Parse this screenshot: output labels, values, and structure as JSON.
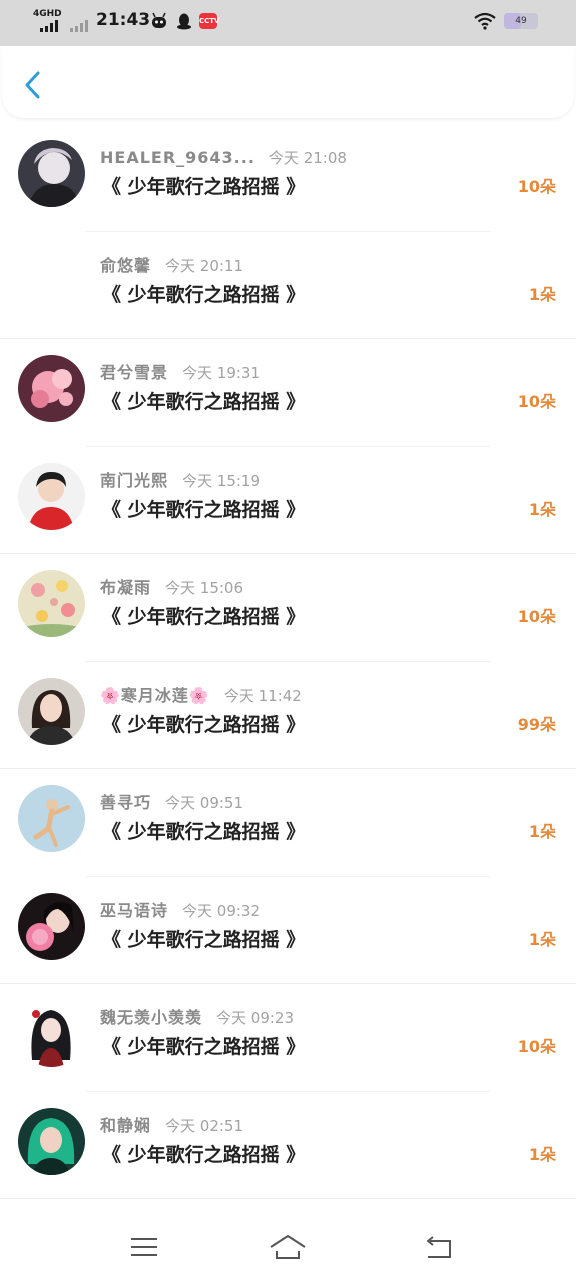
{
  "status_bar": {
    "network": "4GHD",
    "time": "21:43",
    "app_badge": "CCTV",
    "battery": "49",
    "battery_level": 0.49
  },
  "header": {
    "back_icon": "chevron-left-icon",
    "accent_color": "#2c9fd6"
  },
  "colors": {
    "count": "#e38a3c",
    "title": "#222222",
    "meta": "#888888"
  },
  "records": [
    {
      "name": "HEALER_9643...",
      "time": "今天 21:08",
      "title": "《 少年歌行之路招摇 》",
      "count": "10朵",
      "avatar": "silver-hair-person"
    },
    {
      "name": "俞悠馨",
      "time": "今天 20:11",
      "title": "《 少年歌行之路招摇 》",
      "count": "1朵",
      "avatar": "none"
    },
    {
      "name": "君兮雪景",
      "time": "今天 19:31",
      "title": "《 少年歌行之路招摇 》",
      "count": "10朵",
      "avatar": "pink-flowers"
    },
    {
      "name": "南门光熙",
      "time": "今天 15:19",
      "title": "《 少年歌行之路招摇 》",
      "count": "1朵",
      "avatar": "boy-red-shirt"
    },
    {
      "name": "布凝雨",
      "time": "今天 15:06",
      "title": "《 少年歌行之路招摇 》",
      "count": "10朵",
      "avatar": "flower-field"
    },
    {
      "name": "🌸寒月冰莲🌸",
      "time": "今天 11:42",
      "title": "《 少年歌行之路招摇 》",
      "count": "99朵",
      "avatar": "woman-portrait"
    },
    {
      "name": "善寻巧",
      "time": "今天 09:51",
      "title": "《 少年歌行之路招摇 》",
      "count": "1朵",
      "avatar": "dancer-blue-sky"
    },
    {
      "name": "巫马语诗",
      "time": "今天 09:32",
      "title": "《 少年歌行之路招摇 》",
      "count": "1朵",
      "avatar": "girl-pink-flower"
    },
    {
      "name": "魏无羡小羡羡",
      "time": "今天 09:23",
      "title": "《 少年歌行之路招摇 》",
      "count": "10朵",
      "avatar": "anime-character"
    },
    {
      "name": "和静娴",
      "time": "今天 02:51",
      "title": "《 少年歌行之路招摇 》",
      "count": "1朵",
      "avatar": "green-hair-girl"
    }
  ],
  "nav_bar": {
    "menu": "menu-icon",
    "home": "home-icon",
    "back": "back-icon"
  }
}
